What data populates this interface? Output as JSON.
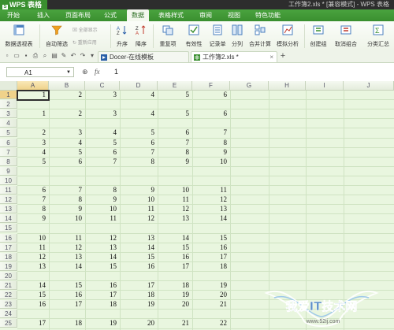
{
  "app": {
    "name": "WPS 表格",
    "window_title": "工作簿2.xls * [兼容模式] - WPS 表格"
  },
  "menu": {
    "items": [
      "开始",
      "插入",
      "页面布局",
      "公式",
      "数据",
      "表格样式",
      "审阅",
      "视图",
      "特色功能"
    ],
    "active": "数据"
  },
  "ribbon": {
    "buttons": [
      "数据透视表",
      "自动筛选",
      "升序",
      "降序",
      "重复项",
      "有效性",
      "记录单",
      "分列",
      "合并计算",
      "模拟分析",
      "创建组",
      "取消组合",
      "分类汇总"
    ],
    "small": [
      "全部显示",
      "重新应用"
    ]
  },
  "tabs": [
    {
      "label": "Docer-在线模板"
    },
    {
      "label": "工作簿2.xls *"
    }
  ],
  "new_tab": "+",
  "formula_bar": {
    "cell_ref": "A1",
    "fx": "fx",
    "value": "1"
  },
  "columns": [
    "A",
    "B",
    "C",
    "D",
    "E",
    "F",
    "G",
    "H",
    "I",
    "J"
  ],
  "rows": [
    "1",
    "2",
    "3",
    "4",
    "5",
    "6",
    "7",
    "8",
    "9",
    "10",
    "11",
    "12",
    "13",
    "14",
    "15",
    "16",
    "17",
    "18",
    "19",
    "20",
    "21",
    "22",
    "23",
    "24",
    "25"
  ],
  "cells": [
    {
      "r": 1,
      "v": [
        "1",
        "2",
        "3",
        "4",
        "5",
        "6"
      ]
    },
    {
      "r": 3,
      "v": [
        "1",
        "2",
        "3",
        "4",
        "5",
        "6"
      ]
    },
    {
      "r": 5,
      "v": [
        "2",
        "3",
        "4",
        "5",
        "6",
        "7"
      ]
    },
    {
      "r": 6,
      "v": [
        "3",
        "4",
        "5",
        "6",
        "7",
        "8"
      ]
    },
    {
      "r": 7,
      "v": [
        "4",
        "5",
        "6",
        "7",
        "8",
        "9"
      ]
    },
    {
      "r": 8,
      "v": [
        "5",
        "6",
        "7",
        "8",
        "9",
        "10"
      ]
    },
    {
      "r": 11,
      "v": [
        "6",
        "7",
        "8",
        "9",
        "10",
        "11"
      ]
    },
    {
      "r": 12,
      "v": [
        "7",
        "8",
        "9",
        "10",
        "11",
        "12"
      ]
    },
    {
      "r": 13,
      "v": [
        "8",
        "9",
        "10",
        "11",
        "12",
        "13"
      ]
    },
    {
      "r": 14,
      "v": [
        "9",
        "10",
        "11",
        "12",
        "13",
        "14"
      ]
    },
    {
      "r": 16,
      "v": [
        "10",
        "11",
        "12",
        "13",
        "14",
        "15"
      ]
    },
    {
      "r": 17,
      "v": [
        "11",
        "12",
        "13",
        "14",
        "15",
        "16"
      ]
    },
    {
      "r": 18,
      "v": [
        "12",
        "13",
        "14",
        "15",
        "16",
        "17"
      ]
    },
    {
      "r": 19,
      "v": [
        "13",
        "14",
        "15",
        "16",
        "17",
        "18"
      ]
    },
    {
      "r": 21,
      "v": [
        "14",
        "15",
        "16",
        "17",
        "18",
        "19"
      ]
    },
    {
      "r": 22,
      "v": [
        "15",
        "16",
        "17",
        "18",
        "19",
        "20"
      ]
    },
    {
      "r": 23,
      "v": [
        "16",
        "17",
        "18",
        "19",
        "20",
        "21"
      ]
    },
    {
      "r": 25,
      "v": [
        "17",
        "18",
        "19",
        "20",
        "21",
        "22"
      ]
    }
  ],
  "watermark": {
    "text": "我爱IT技术网",
    "url": "www.52ij.com"
  },
  "colors": {
    "accent": "#3a8f2f",
    "grid_bg": "#e9f6df",
    "title_bg": "#2d2d2d"
  }
}
